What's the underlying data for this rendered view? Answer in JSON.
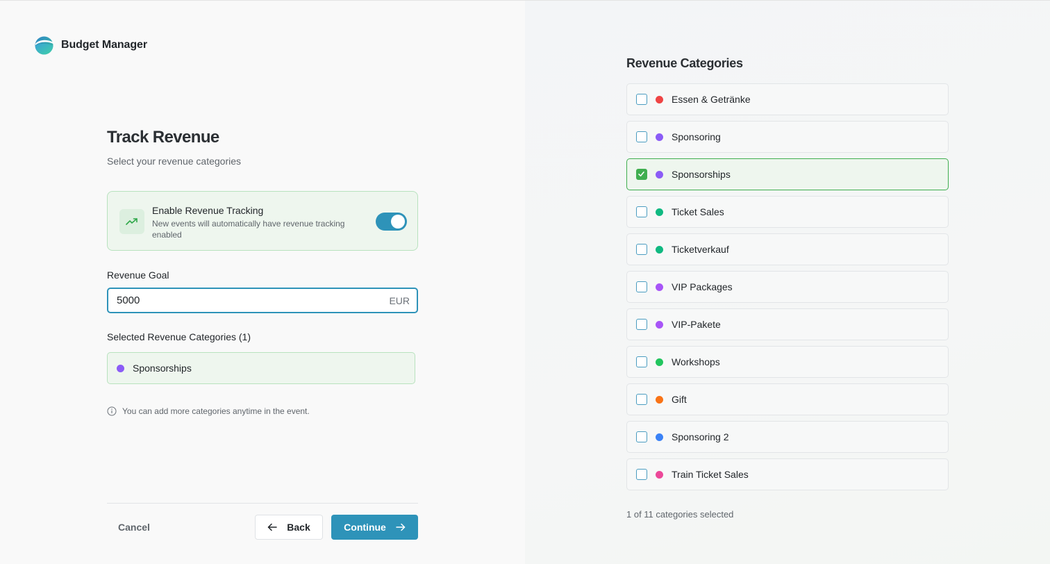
{
  "brand": {
    "name": "Budget Manager"
  },
  "header": {
    "title": "Track Revenue",
    "subtitle": "Select your revenue categories"
  },
  "tracking": {
    "title": "Enable Revenue Tracking",
    "description": "New events will automatically have revenue tracking enabled",
    "enabled": true,
    "icon": "trending-up-icon"
  },
  "goal": {
    "label": "Revenue Goal",
    "value": "5000",
    "unit": "EUR"
  },
  "selected": {
    "label": "Selected Revenue Categories (1)",
    "items": [
      {
        "name": "Sponsorships",
        "color": "#8b5cf6"
      }
    ]
  },
  "hint": {
    "text": "You can add more categories anytime in the event.",
    "icon": "info-icon"
  },
  "footer": {
    "cancel_label": "Cancel",
    "back_label": "Back",
    "continue_label": "Continue"
  },
  "categories": {
    "heading": "Revenue Categories",
    "count_text": "1 of 11 categories selected",
    "items": [
      {
        "name": "Essen & Getränke",
        "color": "#ef4444",
        "checked": false
      },
      {
        "name": "Sponsoring",
        "color": "#8b5cf6",
        "checked": false
      },
      {
        "name": "Sponsorships",
        "color": "#8b5cf6",
        "checked": true
      },
      {
        "name": "Ticket Sales",
        "color": "#10b981",
        "checked": false
      },
      {
        "name": "Ticketverkauf",
        "color": "#10b981",
        "checked": false
      },
      {
        "name": "VIP Packages",
        "color": "#a855f7",
        "checked": false
      },
      {
        "name": "VIP-Pakete",
        "color": "#a855f7",
        "checked": false
      },
      {
        "name": "Workshops",
        "color": "#22c55e",
        "checked": false
      },
      {
        "name": "Gift",
        "color": "#f97316",
        "checked": false
      },
      {
        "name": "Sponsoring 2",
        "color": "#3b82f6",
        "checked": false
      },
      {
        "name": "Train Ticket Sales",
        "color": "#ec4899",
        "checked": false
      }
    ]
  },
  "colors": {
    "accent": "#2e93b9",
    "success": "#3fae4f",
    "success_bg": "#eef6ee"
  }
}
